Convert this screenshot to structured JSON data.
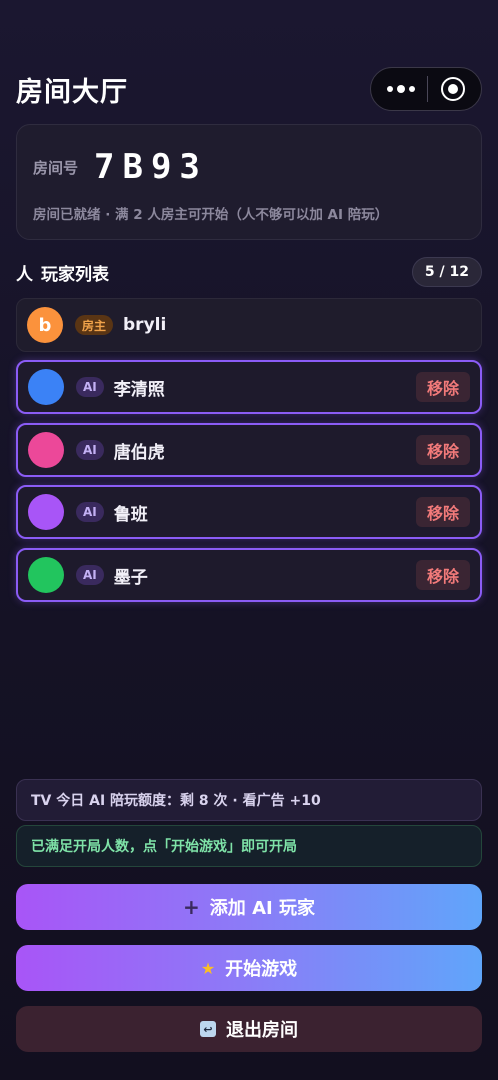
{
  "header": {
    "title": "房间大厅"
  },
  "room": {
    "label": "房间号",
    "code": "7B93",
    "status": "房间已就绪 · 满 2 人房主可开始（人不够可以加 AI 陪玩）"
  },
  "players_section": {
    "icon": "人",
    "title": "玩家列表",
    "count": "5 / 12"
  },
  "players": [
    {
      "name": "bryli",
      "tag": "房主",
      "avatar_letter": "b",
      "avatar_color": "#fb923c"
    },
    {
      "name": "李清照",
      "tag": "AI",
      "avatar_color": "#3b82f6",
      "remove_label": "移除"
    },
    {
      "name": "唐伯虎",
      "tag": "AI",
      "avatar_color": "#ec4899",
      "remove_label": "移除"
    },
    {
      "name": "鲁班",
      "tag": "AI",
      "avatar_color": "#a855f7",
      "remove_label": "移除"
    },
    {
      "name": "墨子",
      "tag": "AI",
      "avatar_color": "#22c55e",
      "remove_label": "移除"
    }
  ],
  "quota": {
    "text": "TV 今日 AI 陪玩额度：剩 8 次 · 看广告 +10"
  },
  "ready": {
    "text": "已满足开局人数，点「开始游戏」即可开局"
  },
  "buttons": {
    "add_ai": {
      "icon": "+",
      "label": "添加 AI 玩家"
    },
    "start": {
      "icon": "★",
      "label": "开始游戏"
    },
    "exit": {
      "icon": "↩",
      "label": "退出房间"
    }
  },
  "colors": {
    "accent": "#8b5cf6",
    "gradient_start": "#a855f7",
    "gradient_end": "#60a5fa",
    "remove_text": "#f27a7a",
    "ready_text": "#7fe3a8"
  }
}
